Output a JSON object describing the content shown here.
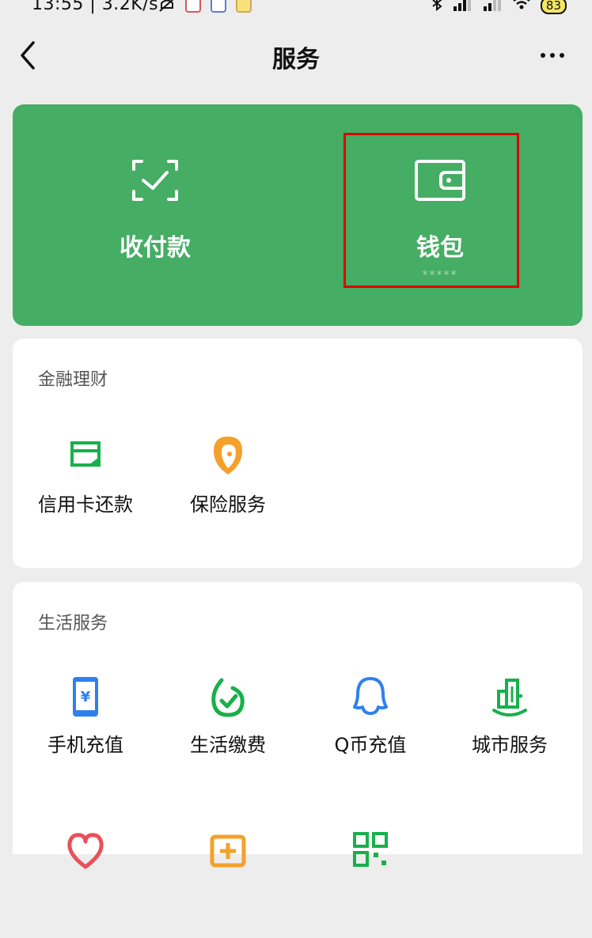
{
  "status_bar": {
    "time": "13:55 | 3.2K/s",
    "battery": "83"
  },
  "nav": {
    "title": "服务"
  },
  "hero": {
    "pay_label": "收付款",
    "wallet_label": "钱包",
    "wallet_balance": "*****",
    "color": "#45ad64"
  },
  "sections": {
    "finance": {
      "title": "金融理财",
      "items": [
        {
          "label": "信用卡还款",
          "icon": "credit-card-icon"
        },
        {
          "label": "保险服务",
          "icon": "insurance-icon"
        }
      ]
    },
    "life": {
      "title": "生活服务",
      "items": [
        {
          "label": "手机充值",
          "icon": "phone-topup-icon"
        },
        {
          "label": "生活缴费",
          "icon": "utility-bill-icon"
        },
        {
          "label": "Q币充值",
          "icon": "qq-coin-icon"
        },
        {
          "label": "城市服务",
          "icon": "city-service-icon"
        }
      ]
    }
  }
}
